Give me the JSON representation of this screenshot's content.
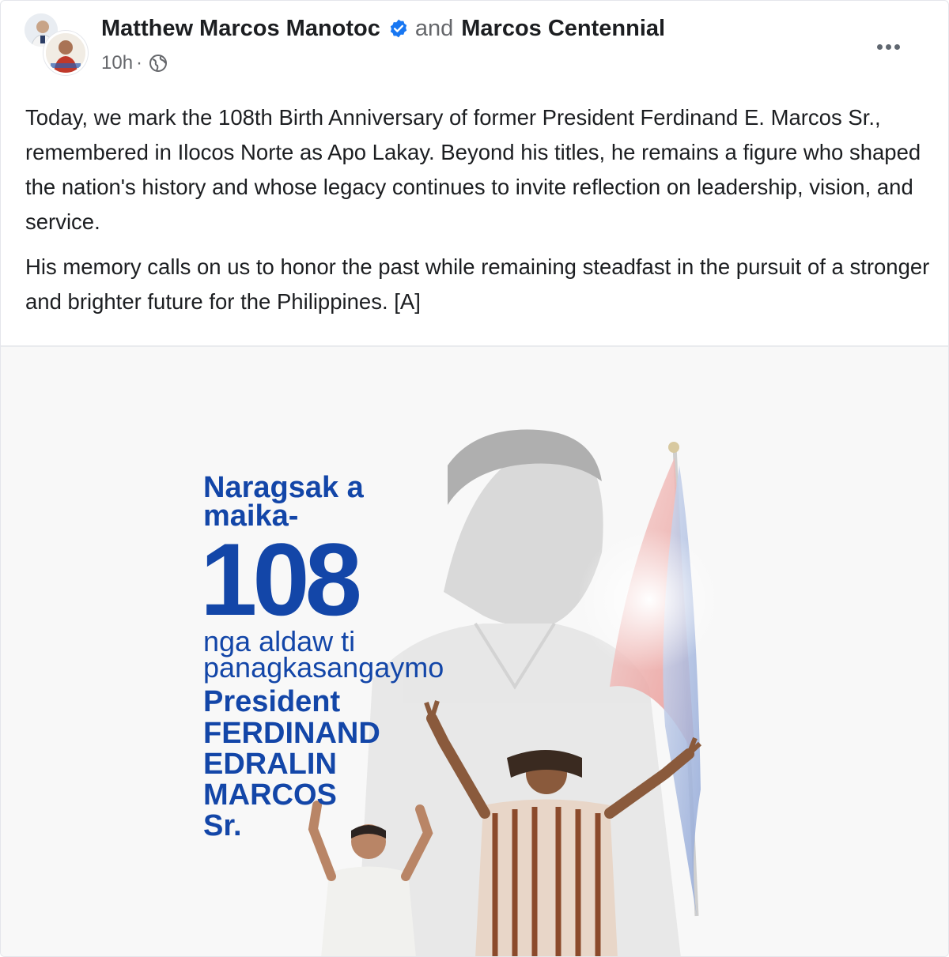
{
  "post": {
    "author_primary": "Matthew Marcos Manotoc",
    "conjunction": "and",
    "author_secondary": "Marcos Centennial",
    "timestamp": "10h",
    "separator": "·",
    "audience_icon": "globe-icon",
    "verified_icon": "verified-badge-icon",
    "more_icon": "more-options-icon",
    "paragraphs": [
      "Today, we mark the 108th Birth Anniversary of former President Ferdinand E. Marcos Sr., remembered in Ilocos Norte as Apo Lakay. Beyond his titles, he remains a figure who shaped the nation's history and whose legacy continues to invite reflection on leadership, vision, and service.",
      "His memory calls on us to honor the past while remaining steadfast in the pursuit of a stronger and brighter future for the Philippines. [A]"
    ]
  },
  "poster": {
    "greeting_line1": "Naragsak a",
    "greeting_line2": "maika-",
    "number": "108",
    "subtitle_line1": "nga aldaw ti",
    "subtitle_line2": "panagkasangaymo",
    "name_lines": [
      "President",
      "FERDINAND",
      "EDRALIN",
      "MARCOS",
      "Sr."
    ]
  },
  "colors": {
    "poster_text": "#1346a8",
    "verified_badge": "#1877f2",
    "meta_text": "#65676b"
  }
}
